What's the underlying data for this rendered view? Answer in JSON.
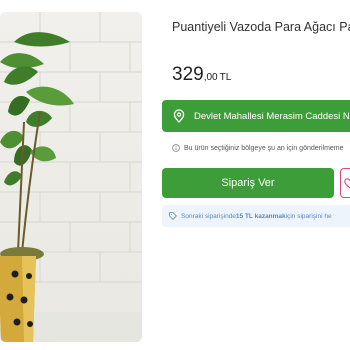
{
  "product": {
    "title": "Puantiyeli Vazoda Para Ağacı Pa",
    "price_main": "329",
    "price_fraction": ",00",
    "currency": "TL"
  },
  "delivery": {
    "address": "Devlet Mahallesi Merasim Caddesi No:",
    "info": "Bu ürün seçtiğiniz bölgeye şu an için gönderilmeme"
  },
  "actions": {
    "order_label": "Sipariş Ver"
  },
  "promo": {
    "prefix": "Sonraki siparişinde ",
    "amount": "15 TL kazanmak",
    "suffix": " için siparişini he"
  },
  "icons": {
    "address": "location-pin-icon",
    "info": "info-circle-icon",
    "favorite": "heart-icon",
    "promo": "tag-icon"
  },
  "colors": {
    "primary_green": "#3d9d39",
    "promo_bg": "#eef4fb",
    "promo_text": "#5a88bf",
    "favorite_pink": "#e1447a"
  }
}
